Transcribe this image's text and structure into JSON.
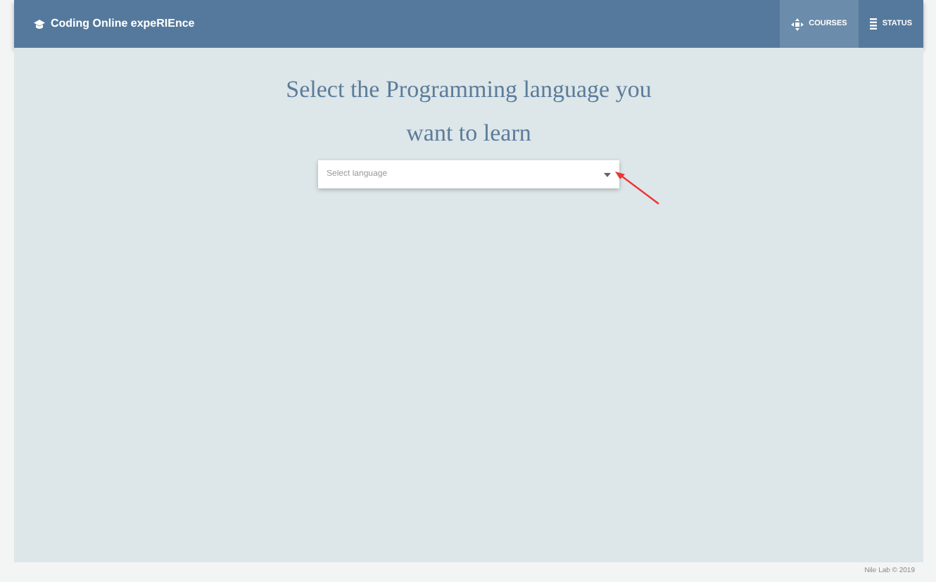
{
  "brand": {
    "title": "Coding Online expeRIEnce"
  },
  "nav_items": [
    {
      "label": "COURSES",
      "kind": "courses",
      "selected": true
    },
    {
      "label": "STATUS",
      "kind": "status",
      "selected": false
    }
  ],
  "heading": "Select the Programming language you want to learn",
  "language_select": {
    "placeholder": "Select language"
  },
  "footer": "Nile Lab © 2019"
}
